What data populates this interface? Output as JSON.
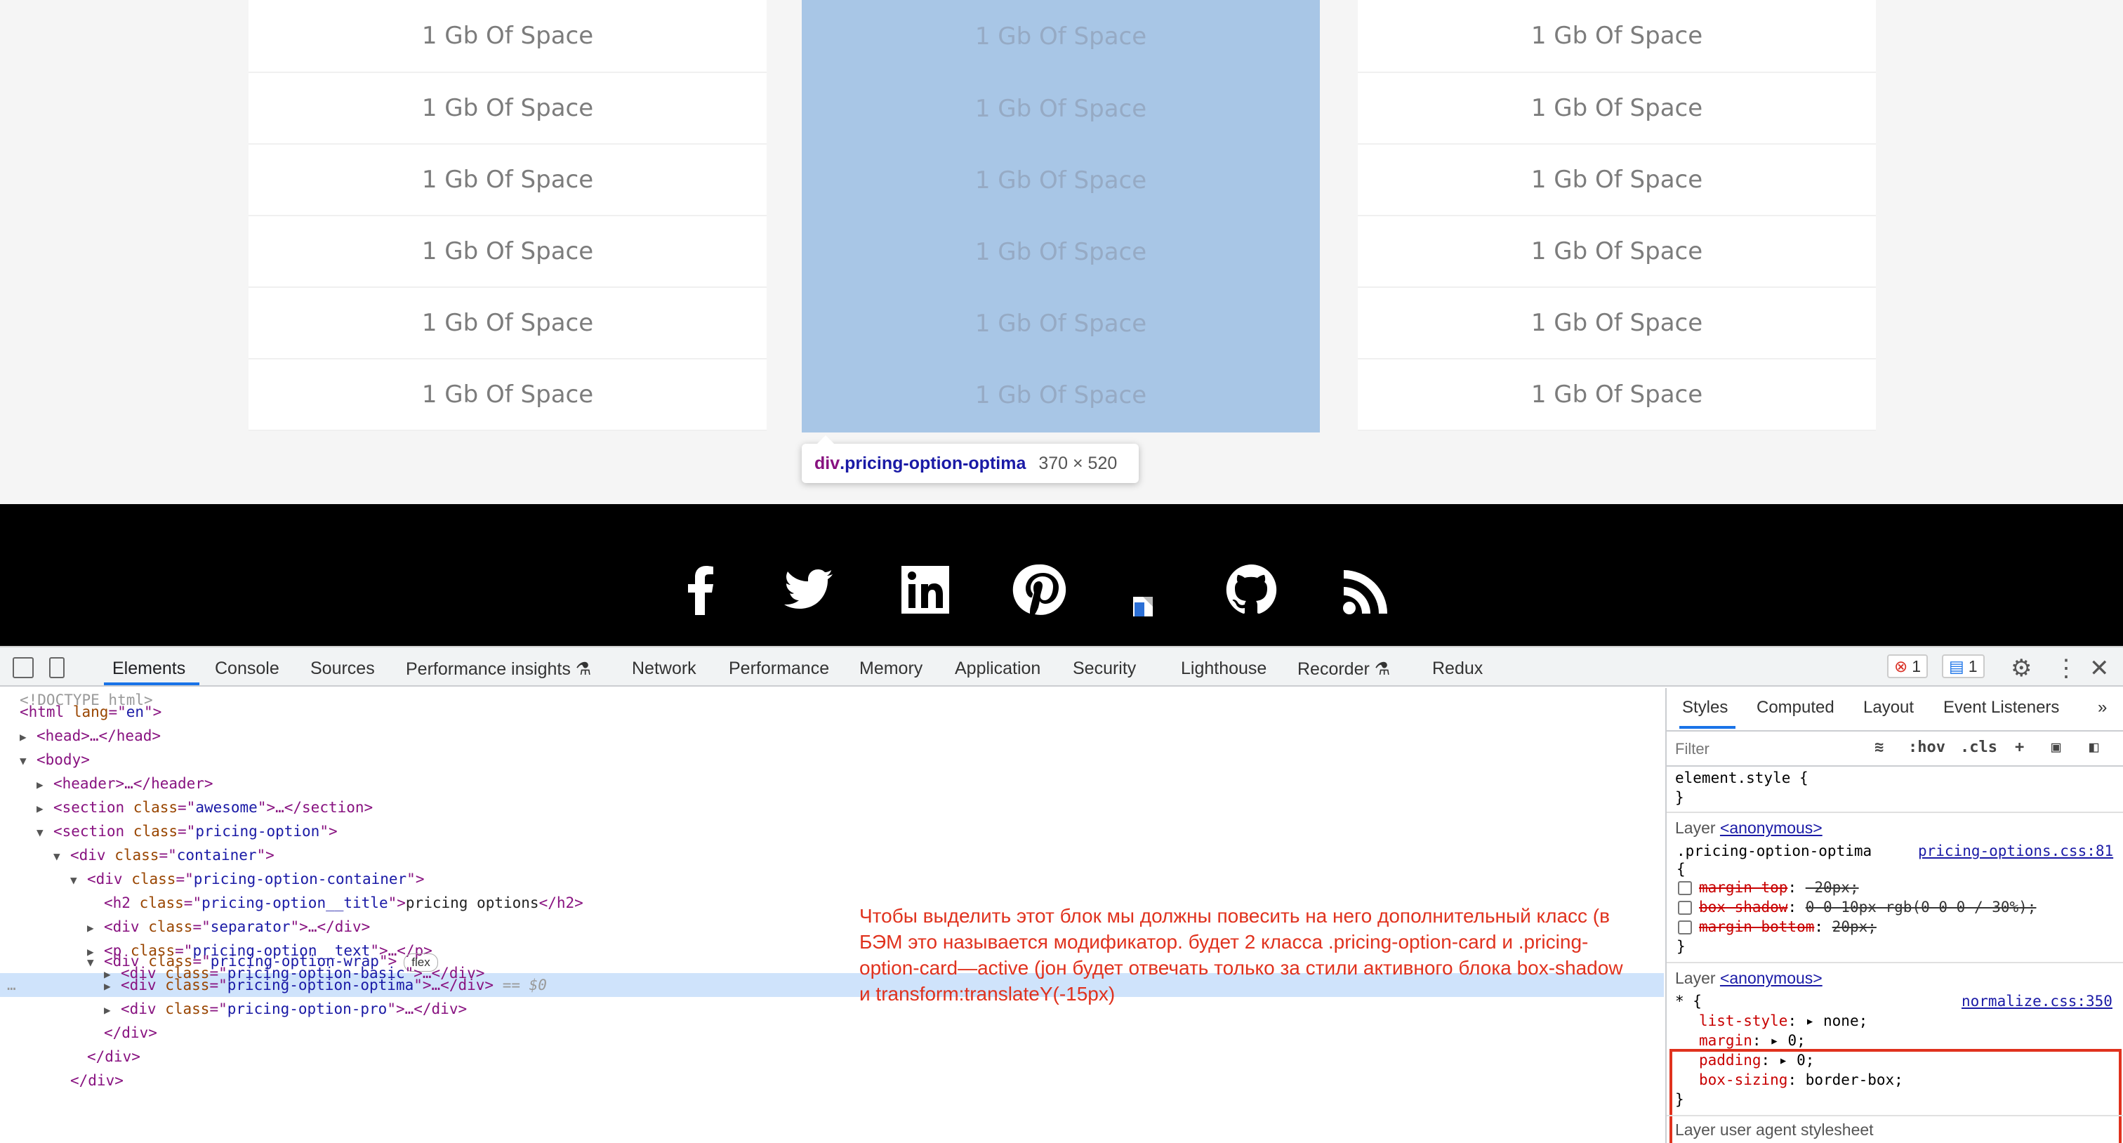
{
  "page": {
    "basic_rows": [
      "1 Gb Of Space",
      "1 Gb Of Space",
      "1 Gb Of Space",
      "1 Gb Of Space",
      "1 Gb Of Space",
      "1 Gb Of Space"
    ],
    "optima_rows": [
      "1 Gb Of Space",
      "1 Gb Of Space",
      "1 Gb Of Space",
      "1 Gb Of Space",
      "1 Gb Of Space",
      "1 Gb Of Space"
    ],
    "pro_rows": [
      "1 Gb Of Space",
      "1 Gb Of Space",
      "1 Gb Of Space",
      "1 Gb Of Space",
      "1 Gb Of Space",
      "1 Gb Of Space"
    ],
    "highlight_color": "#a8c6e6",
    "tooltip": {
      "tag": "div",
      "class": ".pricing-option-optima",
      "size": "370 × 520"
    },
    "social_icons": [
      "facebook-icon",
      "twitter-icon",
      "linkedin-icon",
      "pinterest-icon",
      "broken-image-icon",
      "github-icon",
      "rss-icon"
    ]
  },
  "devtools": {
    "tabs": [
      "Elements",
      "Console",
      "Sources",
      "Performance insights",
      "Network",
      "Performance",
      "Memory",
      "Application",
      "Security",
      "Lighthouse",
      "Recorder",
      "Redux"
    ],
    "active_tab": "Elements",
    "errors_count": "1",
    "messages_count": "1",
    "dom": {
      "doctype": "<!DOCTYPE html>",
      "html_lang": "en",
      "head": "<head>…</head>",
      "header": "<header>…</header>",
      "section_awesome_class": "awesome",
      "section_pricing_class": "pricing-option",
      "container_class": "container",
      "pricing_container_class": "pricing-option-container",
      "h2_class": "pricing-option__title",
      "h2_text": "pricing options",
      "separator_class": "separator",
      "p_class": "pricing-option__text",
      "wrap_class": "pricing-option-wrap",
      "flex_badge": "flex",
      "basic_class": "pricing-option-basic",
      "optima_class": "pricing-option-optima",
      "pro_class": "pricing-option-pro",
      "selected_marker": "== $0"
    },
    "annotation": "Чтобы выделить этот блок мы должны повесить на него дополнительный класс (в БЭМ это называется модификатор. будет 2 класса .pricing-option-card и .pricing-option-card—active (joн будет отвечать только за стили активного блока box-shadow и transform:translateY(-15px)",
    "styles": {
      "tabs": [
        "Styles",
        "Computed",
        "Layout",
        "Event Listeners"
      ],
      "filter_placeholder": "Filter",
      "hov": ":hov",
      "cls": ".cls",
      "element_style": "element.style {",
      "close_brace": "}",
      "layer_label": "Layer",
      "layer_link": "<anonymous>",
      "rule1_selector": ".pricing-option-optima",
      "rule1_source": "pricing-options.css:81",
      "rule1_props": [
        {
          "name": "margin-top",
          "value": "-20px;"
        },
        {
          "name": "box-shadow",
          "value": "0 0 10px rgb(0 0 0 / 30%);"
        },
        {
          "name": "margin-bottom",
          "value": "20px;"
        }
      ],
      "rule2_selector": "* {",
      "rule2_source": "normalize.css:350",
      "rule2_props": [
        {
          "name": "list-style",
          "value": "none;"
        },
        {
          "name": "margin",
          "value": "0;"
        },
        {
          "name": "padding",
          "value": "0;"
        },
        {
          "name": "box-sizing",
          "value": "border-box;"
        }
      ],
      "cut_line": "Layer user agent stylesheet"
    }
  }
}
